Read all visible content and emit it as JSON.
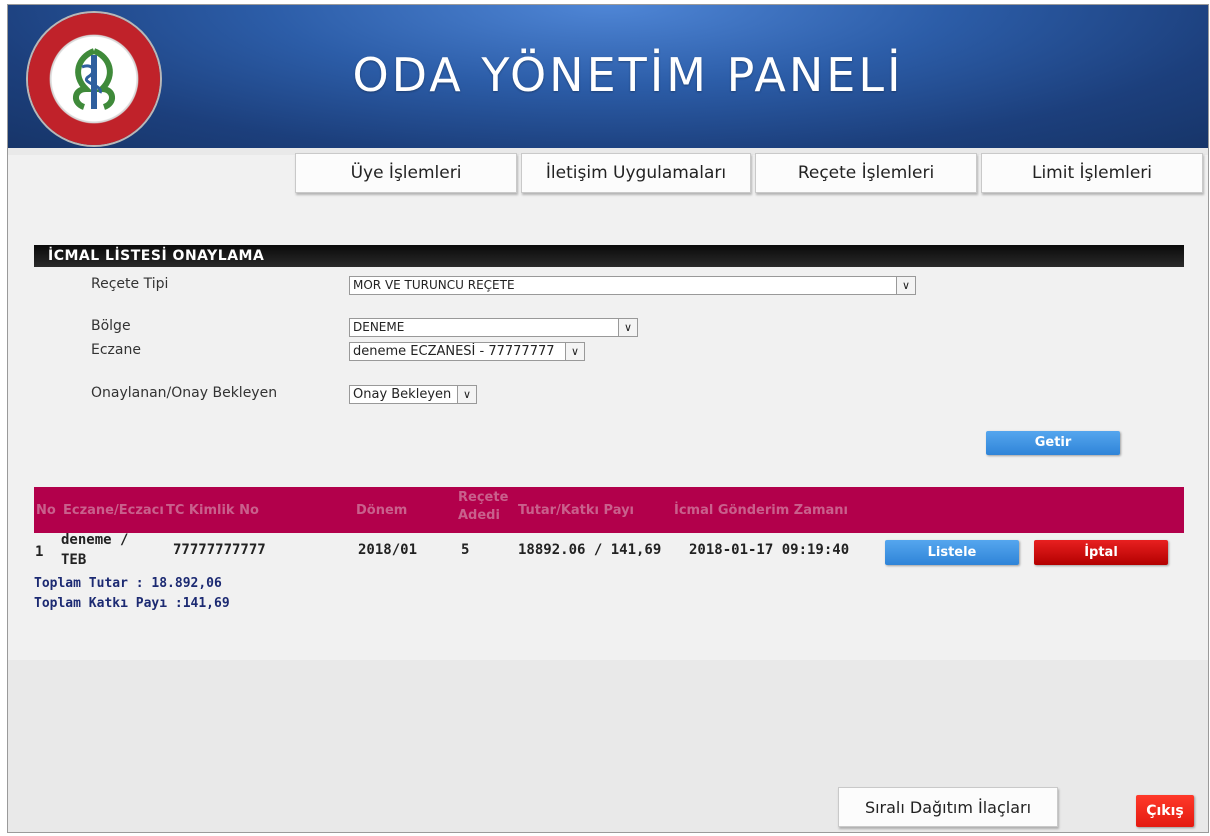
{
  "header": {
    "title": "ODA YÖNETİM PANELİ",
    "logo_text": "TÜRK ECZACILARI BİRLİĞİ"
  },
  "nav": [
    {
      "label": "Üye İşlemleri"
    },
    {
      "label": "İletişim Uygulamaları"
    },
    {
      "label": "Reçete İşlemleri"
    },
    {
      "label": "Limit İşlemleri"
    }
  ],
  "section": {
    "title": "İCMAL LİSTESİ ONAYLAMA"
  },
  "form": {
    "recete_tipi_label": "Reçete Tipi",
    "recete_tipi_value": "MOR VE TURUNCU REÇETE",
    "bolge_label": "Bölge",
    "bolge_value": "DENEME",
    "eczane_label": "Eczane",
    "eczane_value": "deneme ECZANESİ - 77777777",
    "onay_label": "Onaylanan/Onay Bekleyen",
    "onay_value": "Onay Bekleyen",
    "getir_label": "Getir"
  },
  "table": {
    "headers": [
      "No",
      "Eczane/Eczacı",
      "TC Kimlik No",
      "Dönem",
      "Reçete Adedi",
      "Tutar/Katkı Payı",
      "İcmal Gönderim Zamanı"
    ],
    "rows": [
      {
        "no": "1",
        "eczane_line1": "deneme /",
        "eczane_line2": "TEB",
        "tc": "77777777777",
        "donem": "2018/01",
        "adet": "5",
        "tutar": "18892.06 / 141,69",
        "zaman": "2018-01-17 09:19:40",
        "listele_label": "Listele",
        "iptal_label": "İptal"
      }
    ],
    "toplam_tutar": "Toplam Tutar : 18.892,06",
    "toplam_katki": "Toplam Katkı Payı :141,69"
  },
  "footer": {
    "sirali_label": "Sıralı Dağıtım İlaçları",
    "cikis_label": "Çıkış"
  }
}
